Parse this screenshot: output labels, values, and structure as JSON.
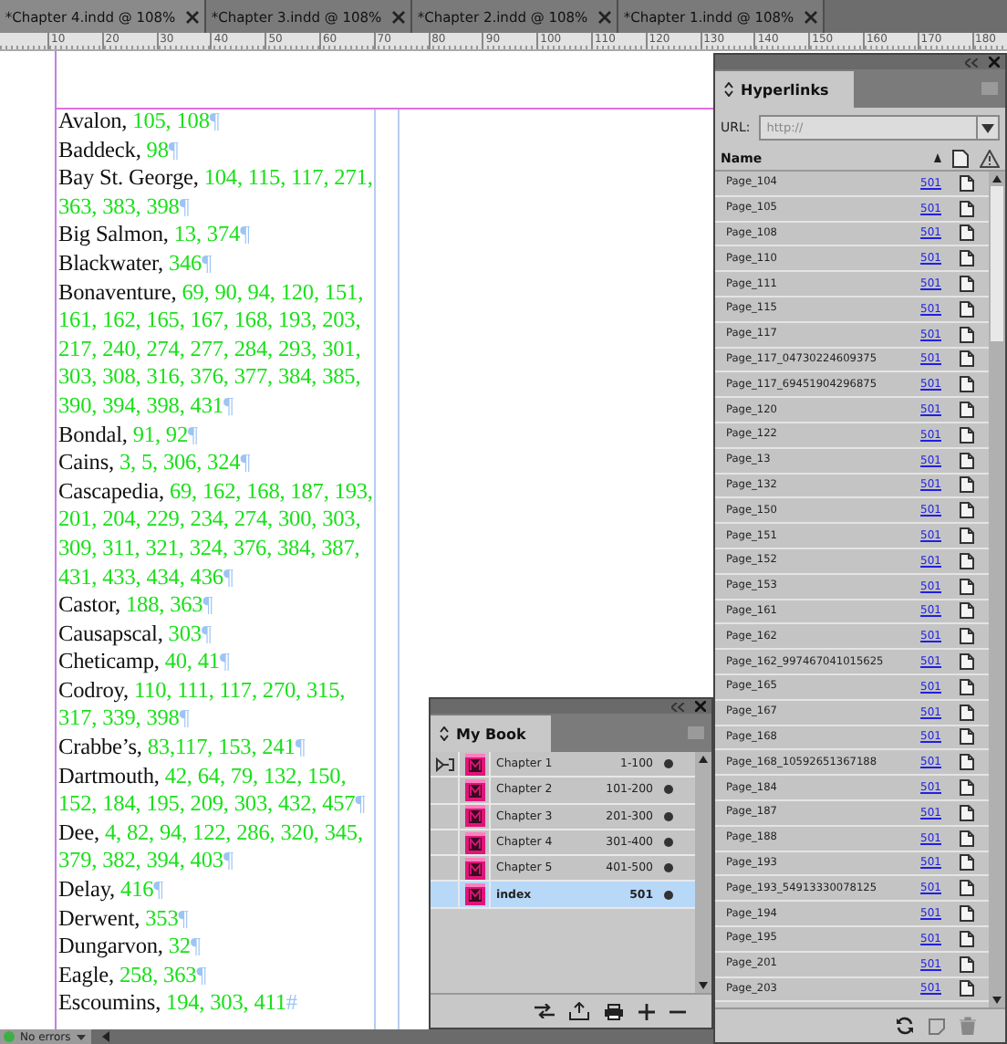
{
  "tabs": [
    {
      "label": "*Chapter 4.indd @ 108%",
      "selected": true
    },
    {
      "label": "*Chapter 3.indd @ 108%",
      "selected": false
    },
    {
      "label": "*Chapter 2.indd @ 108%",
      "selected": false
    },
    {
      "label": "*Chapter 1.indd @ 108%",
      "selected": false
    }
  ],
  "ruler": [
    "10",
    "20",
    "30",
    "40",
    "50",
    "60",
    "70",
    "80",
    "90",
    "100",
    "110",
    "120",
    "130",
    "140",
    "150",
    "160",
    "170",
    "180"
  ],
  "index_entries": [
    {
      "name": "Avalon,",
      "pages": "105, 108",
      "mark": "¶"
    },
    {
      "name": "Baddeck,",
      "pages": "98",
      "mark": "¶"
    },
    {
      "name": "Bay St. George,",
      "pages": "104, 115, 117, 271, 363, 383, 398",
      "mark": "¶"
    },
    {
      "name": "Big Salmon,",
      "pages": "13, 374",
      "mark": "¶"
    },
    {
      "name": "Blackwater,",
      "pages": "346",
      "mark": "¶"
    },
    {
      "name": "Bonaventure,",
      "pages": "69, 90, 94, 120, 151, 161, 162, 165, 167, 168, 193, 203, 217, 240, 274, 277, 284, 293, 301, 303, 308, 316, 376, 377, 384, 385, 390, 394, 398, 431",
      "mark": "¶"
    },
    {
      "name": "Bondal,",
      "pages": "91, 92",
      "mark": "¶"
    },
    {
      "name": "Cains,",
      "pages": "3, 5, 306, 324",
      "mark": "¶"
    },
    {
      "name": "Cascapedia,",
      "pages": "69, 162, 168, 187, 193, 201, 204, 229, 234, 274, 300, 303, 309, 311, 321, 324, 376, 384, 387, 431, 433, 434, 436",
      "mark": "¶"
    },
    {
      "name": "Castor,",
      "pages": "188, 363",
      "mark": "¶"
    },
    {
      "name": "Causapscal,",
      "pages": "303",
      "mark": "¶"
    },
    {
      "name": "Cheticamp,",
      "pages": "40, 41",
      "mark": "¶"
    },
    {
      "name": "Codroy,",
      "pages": "110, 111, 117, 270, 315, 317, 339, 398",
      "mark": "¶"
    },
    {
      "name": "Crabbe’s,",
      "pages": "83,117, 153, 241",
      "mark": "¶"
    },
    {
      "name": "Dartmouth,",
      "pages": "42, 64, 79, 132, 150, 152, 184, 195, 209, 303, 432, 457",
      "mark": "¶"
    },
    {
      "name": "Dee,",
      "pages": "4, 82, 94, 122, 286, 320, 345, 379, 382, 394, 403",
      "mark": "¶"
    },
    {
      "name": "Delay,",
      "pages": "416",
      "mark": "¶"
    },
    {
      "name": "Derwent,",
      "pages": "353",
      "mark": "¶"
    },
    {
      "name": "Dungarvon,",
      "pages": "32",
      "mark": "¶"
    },
    {
      "name": "Eagle,",
      "pages": "258, 363",
      "mark": "¶"
    },
    {
      "name": "Escoumins,",
      "pages": "194, 303, 411",
      "mark": "#"
    }
  ],
  "hyperlinks_panel": {
    "title": "Hyperlinks",
    "url_label": "URL:",
    "url_value": "http://",
    "name_header": "Name",
    "rows": [
      {
        "name": "Page_104",
        "page": "501"
      },
      {
        "name": "Page_105",
        "page": "501"
      },
      {
        "name": "Page_108",
        "page": "501"
      },
      {
        "name": "Page_110",
        "page": "501"
      },
      {
        "name": "Page_111",
        "page": "501"
      },
      {
        "name": "Page_115",
        "page": "501"
      },
      {
        "name": "Page_117",
        "page": "501"
      },
      {
        "name": "Page_117_04730224609375",
        "page": "501"
      },
      {
        "name": "Page_117_69451904296875",
        "page": "501"
      },
      {
        "name": "Page_120",
        "page": "501"
      },
      {
        "name": "Page_122",
        "page": "501"
      },
      {
        "name": "Page_13",
        "page": "501"
      },
      {
        "name": "Page_132",
        "page": "501"
      },
      {
        "name": "Page_150",
        "page": "501"
      },
      {
        "name": "Page_151",
        "page": "501"
      },
      {
        "name": "Page_152",
        "page": "501"
      },
      {
        "name": "Page_153",
        "page": "501"
      },
      {
        "name": "Page_161",
        "page": "501"
      },
      {
        "name": "Page_162",
        "page": "501"
      },
      {
        "name": "Page_162_997467041015625",
        "page": "501"
      },
      {
        "name": "Page_165",
        "page": "501"
      },
      {
        "name": "Page_167",
        "page": "501"
      },
      {
        "name": "Page_168",
        "page": "501"
      },
      {
        "name": "Page_168_10592651367188",
        "page": "501"
      },
      {
        "name": "Page_184",
        "page": "501"
      },
      {
        "name": "Page_187",
        "page": "501"
      },
      {
        "name": "Page_188",
        "page": "501"
      },
      {
        "name": "Page_193",
        "page": "501"
      },
      {
        "name": "Page_193_54913330078125",
        "page": "501"
      },
      {
        "name": "Page_194",
        "page": "501"
      },
      {
        "name": "Page_195",
        "page": "501"
      },
      {
        "name": "Page_201",
        "page": "501"
      },
      {
        "name": "Page_203",
        "page": "501"
      }
    ]
  },
  "book_panel": {
    "title": "My Book",
    "rows": [
      {
        "name": "Chapter 1",
        "pages": "1-100",
        "synced_source": true,
        "selected": false
      },
      {
        "name": "Chapter 2",
        "pages": "101-200",
        "synced_source": false,
        "selected": false
      },
      {
        "name": "Chapter 3",
        "pages": "201-300",
        "synced_source": false,
        "selected": false
      },
      {
        "name": "Chapter 4",
        "pages": "301-400",
        "synced_source": false,
        "selected": false
      },
      {
        "name": "Chapter 5",
        "pages": "401-500",
        "synced_source": false,
        "selected": false
      },
      {
        "name": "index",
        "pages": "501",
        "synced_source": false,
        "selected": true
      }
    ]
  },
  "status_bar": {
    "message": "No errors"
  }
}
